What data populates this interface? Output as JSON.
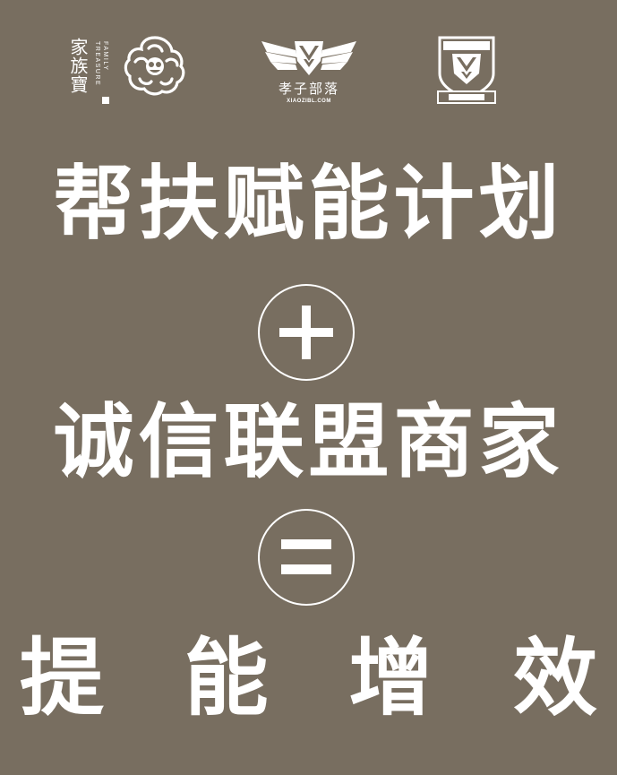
{
  "logos": {
    "family_treasure": {
      "chinese": "家族寶",
      "english": "FAMILY TREASURE"
    },
    "xiaozi": {
      "chinese": "孝子部落",
      "domain": "XIAOZIBL.COM"
    },
    "shield": {
      "icon": "shield-badge-icon"
    }
  },
  "headline": {
    "line1": "帮扶赋能计划",
    "line2": "诚信联盟商家",
    "line3": [
      "提",
      "能",
      "增",
      "效"
    ]
  },
  "operators": {
    "plus": "plus-icon",
    "equals": "equals-icon"
  },
  "colors": {
    "background": "#786e60",
    "foreground": "#ffffff"
  }
}
